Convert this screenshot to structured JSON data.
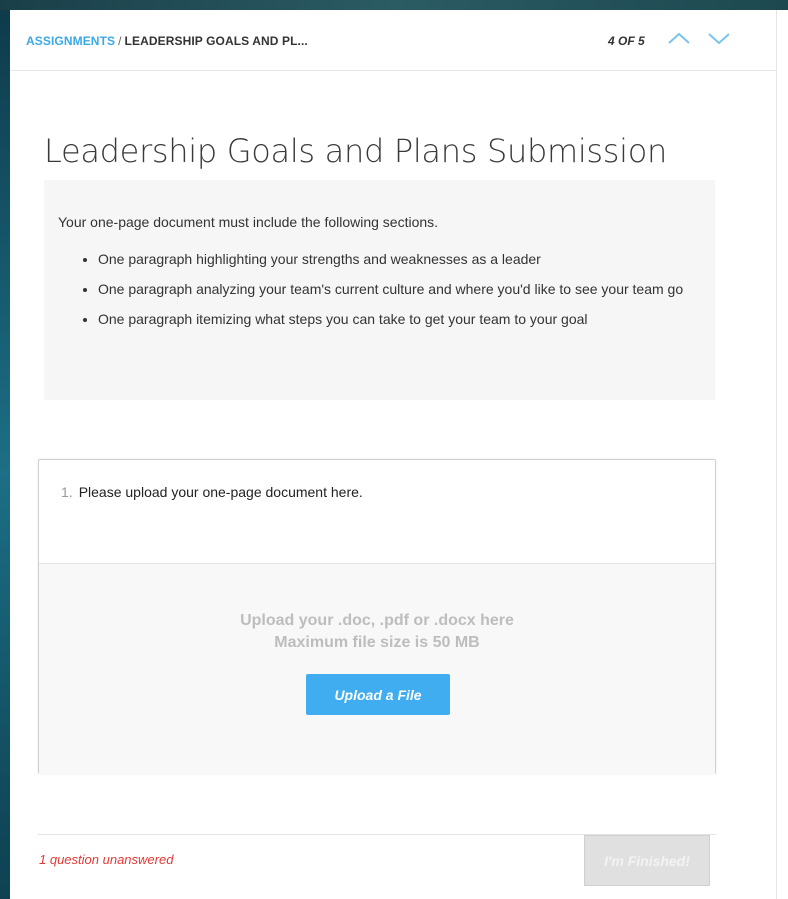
{
  "header": {
    "breadcrumb_root": "ASSIGNMENTS",
    "breadcrumb_sep": "/",
    "breadcrumb_current": "LEADERSHIP GOALS AND PL...",
    "counter": "4 OF 5"
  },
  "title": "Leadership Goals and Plans Submission",
  "instructions": {
    "intro": "Your one-page document must include the following sections.",
    "items": [
      "One paragraph highlighting your strengths and weaknesses as a leader",
      "One paragraph analyzing your team's current culture and where you'd like to see your team go",
      "One paragraph itemizing what steps you can take to get your team to your goal"
    ]
  },
  "question": {
    "number": "1.",
    "text": "Please upload your one-page document here.",
    "upload_line1": "Upload your .doc, .pdf or .docx here",
    "upload_line2": "Maximum file size is 50 MB",
    "upload_button": "Upload a File"
  },
  "footer": {
    "unanswered": "1 question unanswered",
    "finish_button": "I'm Finished!"
  },
  "colors": {
    "accent": "#3aa9e6",
    "button": "#40adf0",
    "warning": "#e53935"
  }
}
